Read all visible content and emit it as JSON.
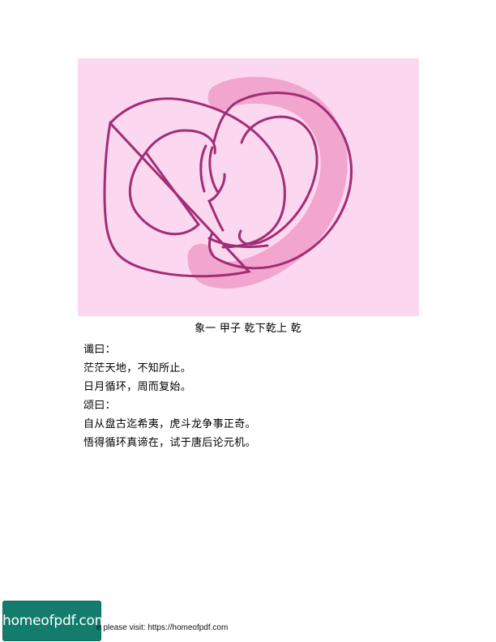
{
  "figure": {
    "colors": {
      "background": "#fbd8ef",
      "ring_outline": "#a12d75",
      "ring_fill": "#f2a6cf"
    }
  },
  "caption": "象一 甲子 乾下乾上 乾",
  "text_lines": [
    "谶曰：",
    "茫茫天地，不知所止。",
    "日月循环，周而复始。",
    "颂曰：",
    "自从盘古迄希夷，虎斗龙争事正奇。",
    "悟得循环真谛在，试于唐后论元机。"
  ],
  "footer": {
    "logo_text": "homeofpdf.com",
    "visit_text": "e please visit: https://homeofpdf.com",
    "logo_color": "#137c6d"
  }
}
